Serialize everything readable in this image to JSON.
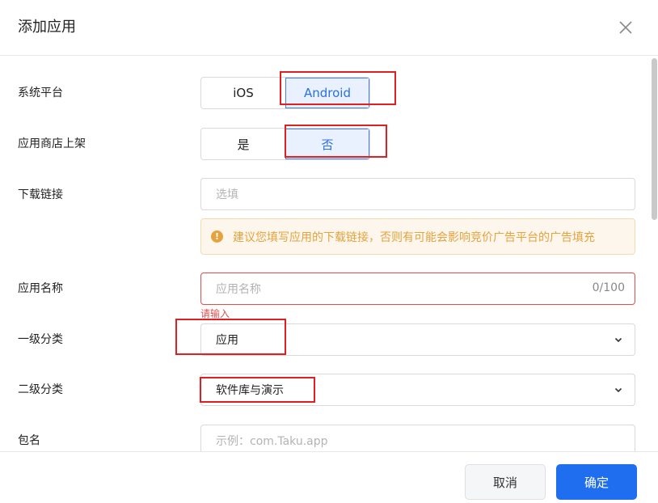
{
  "dialog": {
    "title": "添加应用"
  },
  "platform": {
    "label": "系统平台",
    "options": [
      "iOS",
      "Android"
    ],
    "selected": "Android"
  },
  "store_listed": {
    "label": "应用商店上架",
    "options": [
      "是",
      "否"
    ],
    "selected": "否"
  },
  "download_link": {
    "label": "下载链接",
    "placeholder": "选填",
    "value": "",
    "tip": "建议您填写应用的下载链接，否则有可能会影响竞价广告平台的广告填充",
    "tip_icon": "!"
  },
  "app_name": {
    "label": "应用名称",
    "placeholder": "应用名称",
    "counter": "0/100",
    "error": "请输入"
  },
  "category1": {
    "label": "一级分类",
    "value": "应用"
  },
  "category2": {
    "label": "二级分类",
    "value": "软件库与演示"
  },
  "package": {
    "label": "包名",
    "placeholder": "示例：com.Taku.app"
  },
  "footer": {
    "cancel": "取消",
    "confirm": "确定"
  },
  "colors": {
    "primary": "#1f6ef0",
    "error": "#e34d4d",
    "warning": "#e6a23c",
    "highlight": "#e02020"
  }
}
